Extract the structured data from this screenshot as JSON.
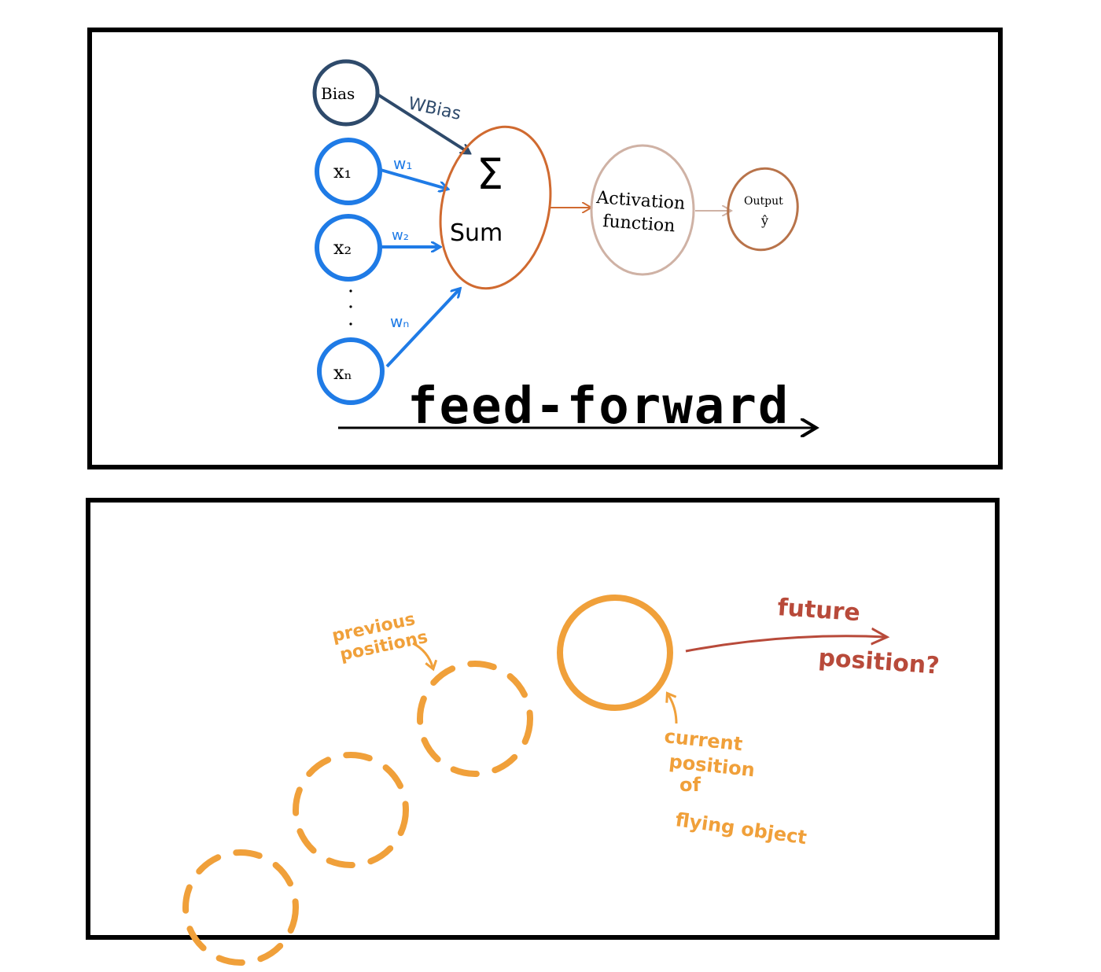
{
  "top_panel": {
    "bias_label": "Bias",
    "bias_weight_label": "WBias",
    "inputs": [
      {
        "label": "x₁",
        "weight": "w₁"
      },
      {
        "label": "x₂",
        "weight": "w₂"
      },
      {
        "label": "xₙ",
        "weight": "wₙ"
      }
    ],
    "sum_symbol": "Σ",
    "sum_label": "Sum",
    "activation_label_line1": "Activation",
    "activation_label_line2": "function",
    "output_label": "Output",
    "output_symbol": "ŷ",
    "feed_forward_label": "feed-forward",
    "colors": {
      "input_blue": "#1f7be6",
      "bias_navy": "#2e4a6b",
      "sum_orange": "#d06a30",
      "activation_tan": "#cfb2a5",
      "output_brown": "#b8734a",
      "black": "#000000"
    }
  },
  "bottom_panel": {
    "previous_label_line1": "previous",
    "previous_label_line2": "positions",
    "current_label_line1": "current",
    "current_label_line2": "position",
    "current_label_line3": "of",
    "current_label_line4": "flying object",
    "future_label_line1": "future",
    "future_label_line2": "position?",
    "colors": {
      "orange": "#f0a03a",
      "red": "#b84a3a"
    }
  }
}
